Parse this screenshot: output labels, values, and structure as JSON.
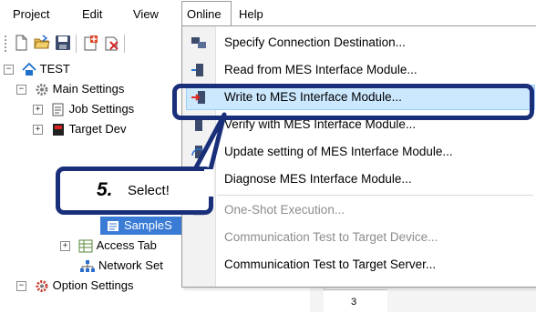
{
  "menubar": {
    "items": [
      "Project",
      "Edit",
      "View",
      "Online",
      "Help"
    ]
  },
  "tree": {
    "root": "TEST",
    "main_settings": "Main Settings",
    "job_settings": "Job Settings",
    "target_device": "Target Dev",
    "sample": "SampleS",
    "access_table": "Access Tab",
    "network_settings": "Network Set",
    "option_settings": "Option Settings"
  },
  "online_menu": {
    "items": [
      {
        "label": "Specify Connection Destination...",
        "icon": "connection-icon",
        "enabled": true
      },
      {
        "label": "Read from MES Interface Module...",
        "icon": "read-icon",
        "enabled": true
      },
      {
        "label": "Write to MES Interface Module...",
        "icon": "write-icon",
        "enabled": true,
        "highlighted": true
      },
      {
        "label": "Verify with MES Interface Module...",
        "icon": "verify-icon",
        "enabled": true
      },
      {
        "label": "Update setting of MES Interface Module...",
        "icon": "update-icon",
        "enabled": true
      },
      {
        "label": "Diagnose MES Interface Module...",
        "icon": "diagnose-icon",
        "enabled": true
      },
      {
        "label": "One-Shot Execution...",
        "icon": "one-shot-icon",
        "enabled": false
      },
      {
        "label": "Communication Test to Target Device...",
        "icon": "",
        "enabled": false
      },
      {
        "label": "Communication Test to Target Server...",
        "icon": "",
        "enabled": true
      }
    ]
  },
  "callout": {
    "step": "5.",
    "text": "Select!"
  },
  "grid": {
    "row_number": "3"
  },
  "colors": {
    "annotation_frame": "#1a2f7a",
    "menu_highlight": "#cce8ff"
  }
}
